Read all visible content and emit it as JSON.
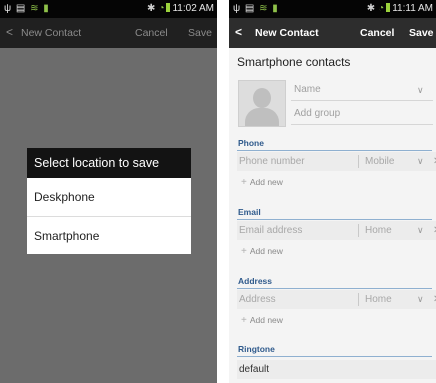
{
  "left": {
    "status_time": "11:02 AM",
    "action_bar": {
      "back": "<",
      "title": "New Contact",
      "cancel": "Cancel",
      "save": "Save"
    },
    "dialog": {
      "title": "Select location to save",
      "options": [
        "Deskphone",
        "Smartphone"
      ]
    }
  },
  "right": {
    "status_time": "11:11 AM",
    "action_bar": {
      "back": "<",
      "title": "New Contact",
      "cancel": "Cancel",
      "save": "Save"
    },
    "section_title": "Smartphone contacts",
    "name_placeholder": "Name",
    "group_placeholder": "Add group",
    "phone": {
      "label": "Phone",
      "placeholder": "Phone number",
      "type": "Mobile",
      "add": "Add new"
    },
    "email": {
      "label": "Email",
      "placeholder": "Email address",
      "type": "Home",
      "add": "Add new"
    },
    "address": {
      "label": "Address",
      "placeholder": "Address",
      "type": "Home",
      "add": "Add new"
    },
    "ringtone": {
      "label": "Ringtone",
      "value": "default"
    }
  },
  "icons": {
    "back": "back-arrow-icon",
    "chevron": "chevron-down-icon",
    "remove": "remove-icon",
    "add": "plus-icon",
    "avatar": "contact-avatar-icon"
  }
}
